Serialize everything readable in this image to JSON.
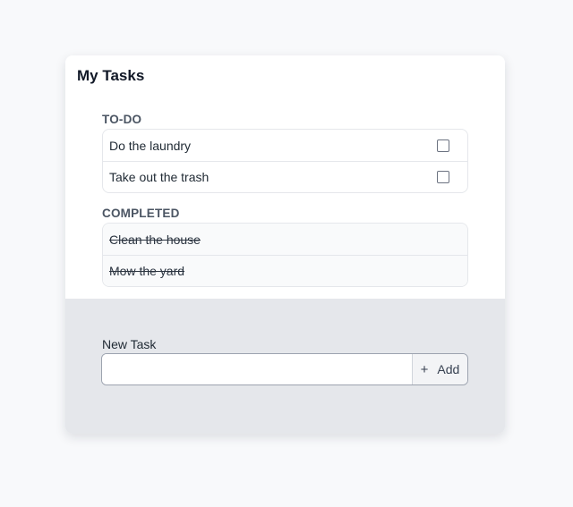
{
  "title": "My Tasks",
  "todo": {
    "heading": "TO-DO",
    "items": [
      {
        "label": "Do the laundry",
        "checked": false
      },
      {
        "label": "Take out the trash",
        "checked": false
      }
    ]
  },
  "completed": {
    "heading": "COMPLETED",
    "items": [
      {
        "label": "Clean the house"
      },
      {
        "label": "Mow the yard"
      }
    ]
  },
  "new_task": {
    "label": "New Task",
    "value": "",
    "placeholder": "",
    "add_icon": "+",
    "add_label": "Add"
  }
}
